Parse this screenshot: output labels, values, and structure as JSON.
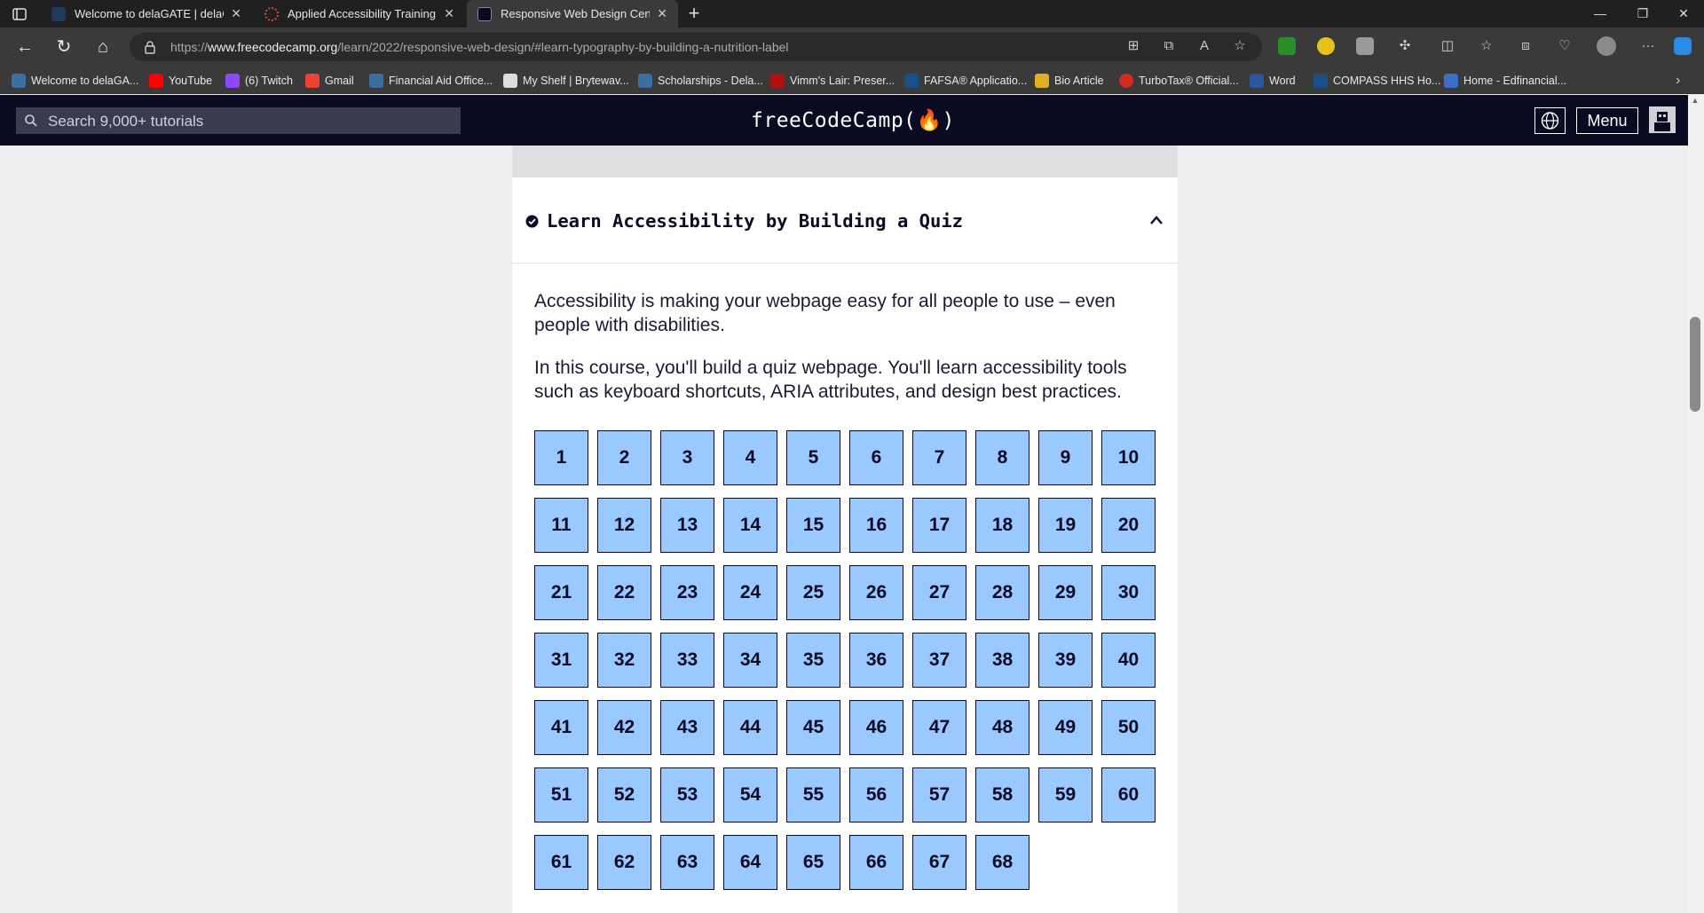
{
  "browser": {
    "tabs": [
      {
        "title": "Welcome to delaGATE | delaGATE",
        "favicon_color": "#1f3b5c"
      },
      {
        "title": "Applied Accessibility Training",
        "favicon_color": "#e0443a"
      },
      {
        "title": "Responsive Web Design Certification",
        "favicon_color": "#0a0a23"
      }
    ],
    "url_prefix": "https://",
    "url_host": "www.freecodecamp.org",
    "url_path": "/learn/2022/responsive-web-design/#learn-typography-by-building-a-nutrition-label",
    "bookmarks": [
      {
        "label": "Welcome to delaGA...",
        "color": "#3b6fa0"
      },
      {
        "label": "YouTube",
        "color": "#ff0000"
      },
      {
        "label": "(6) Twitch",
        "color": "#9146ff"
      },
      {
        "label": "Gmail",
        "color": "#ea4335"
      },
      {
        "label": "Financial Aid Office...",
        "color": "#3b6fa0"
      },
      {
        "label": "My Shelf | Brytewav...",
        "color": "#dddddd"
      },
      {
        "label": "Scholarships - Dela...",
        "color": "#3b6fa0"
      },
      {
        "label": "Vimm's Lair: Preser...",
        "color": "#b01010"
      },
      {
        "label": "FAFSA® Applicatio...",
        "color": "#1a4f8a"
      },
      {
        "label": "Bio Article",
        "color": "#e0b020"
      },
      {
        "label": "TurboTax® Official...",
        "color": "#d52b1e"
      },
      {
        "label": "Word",
        "color": "#2b579a"
      },
      {
        "label": "COMPASS HHS Ho...",
        "color": "#1a4f8a"
      },
      {
        "label": "Home - Edfinancial...",
        "color": "#3a6fc4"
      }
    ]
  },
  "fcc": {
    "search_placeholder": "Search 9,000+ tutorials",
    "logo": "freeCodeCamp(🔥)",
    "menu_label": "Menu"
  },
  "block": {
    "title": "Learn Accessibility by Building a Quiz",
    "description_1": "Accessibility is making your webpage easy for all people to use – even people with disabilities.",
    "description_2": "In this course, you'll build a quiz webpage. You'll learn accessibility tools such as keyboard shortcuts, ARIA attributes, and design best practices.",
    "steps": [
      "1",
      "2",
      "3",
      "4",
      "5",
      "6",
      "7",
      "8",
      "9",
      "10",
      "11",
      "12",
      "13",
      "14",
      "15",
      "16",
      "17",
      "18",
      "19",
      "20",
      "21",
      "22",
      "23",
      "24",
      "25",
      "26",
      "27",
      "28",
      "29",
      "30",
      "31",
      "32",
      "33",
      "34",
      "35",
      "36",
      "37",
      "38",
      "39",
      "40",
      "41",
      "42",
      "43",
      "44",
      "45",
      "46",
      "47",
      "48",
      "49",
      "50",
      "51",
      "52",
      "53",
      "54",
      "55",
      "56",
      "57",
      "58",
      "59",
      "60",
      "61",
      "62",
      "63",
      "64",
      "65",
      "66",
      "67",
      "68"
    ]
  },
  "colors": {
    "step_bg": "#99c9ff",
    "navbar_bg": "#0a0a23"
  }
}
